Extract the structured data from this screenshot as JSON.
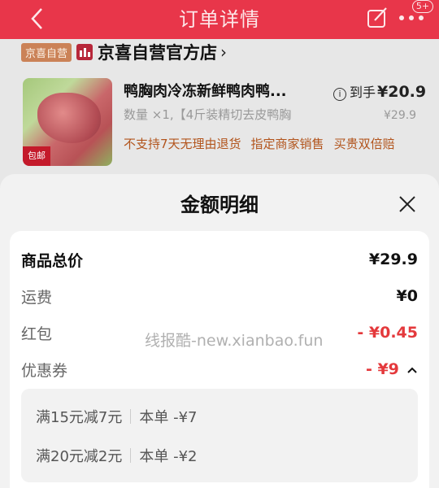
{
  "header": {
    "title": "订单详情",
    "badge": "5+",
    "color": "#e8364a"
  },
  "store": {
    "tag": "京喜自营",
    "name": "京喜自营官方店",
    "arrow": "›"
  },
  "product": {
    "name": "鸭胸肉冷冻新鲜鸭肉鸭...",
    "image_tag": "包邮",
    "price_label": "到手",
    "price": "¥20.9",
    "spec": "数量 ×1,【4斤装精切去皮鸭胸",
    "original_price": "¥29.9",
    "tags": [
      "不支持7天无理由退货",
      "指定商家销售",
      "买贵双倍赔"
    ]
  },
  "sheet": {
    "title": "金额明细",
    "rows": [
      {
        "label": "商品总价",
        "value": "¥29.9"
      },
      {
        "label": "运费",
        "value": "¥0"
      },
      {
        "label": "红包",
        "value": "- ¥0.45"
      },
      {
        "label": "优惠券",
        "value": "- ¥9"
      }
    ],
    "coupons": [
      {
        "name": "满15元减7元",
        "detail": "本单 -¥7"
      },
      {
        "name": "满20元减2元",
        "detail": "本单 -¥2"
      }
    ],
    "watermark": "线报酷-new.xianbao.fun"
  },
  "colors": {
    "accent_red": "#e4393c",
    "header_red": "#e8364a"
  }
}
